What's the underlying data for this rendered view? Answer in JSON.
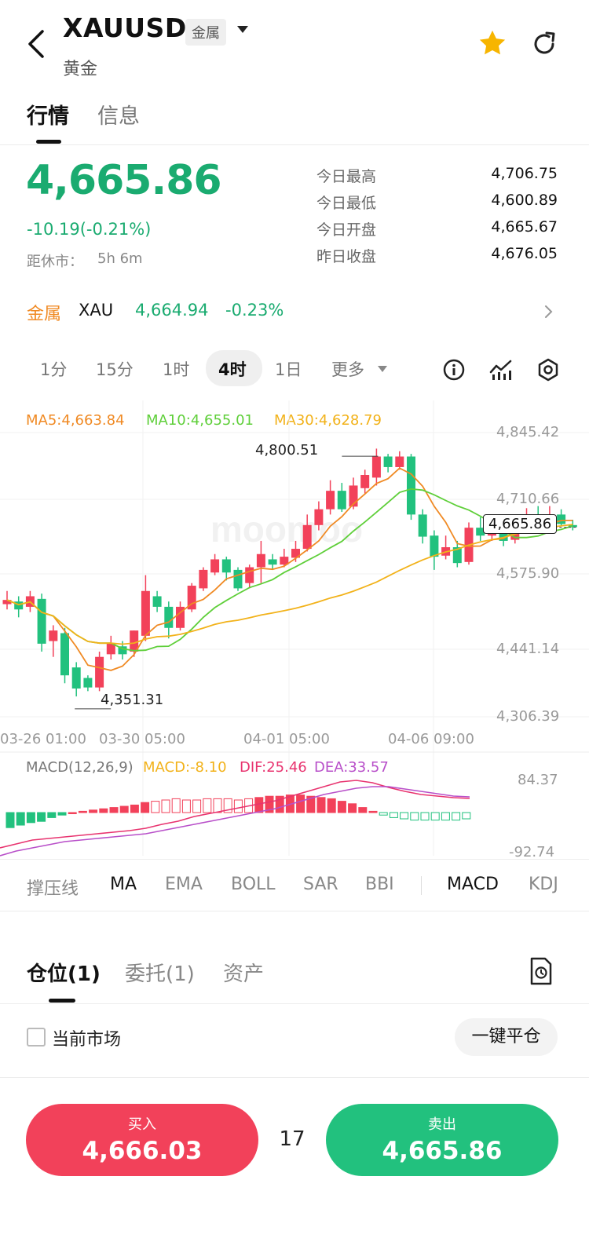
{
  "header": {
    "symbol": "XAUUSD",
    "category_badge": "金属",
    "subtitle": "黄金"
  },
  "tabs": [
    "行情",
    "信息"
  ],
  "quote": {
    "last": "4,665.86",
    "change": "-10.19(-0.21%)",
    "close_label": "距休市：",
    "close_value": "5h 6m",
    "stats": [
      {
        "label": "今日最高",
        "value": "4,706.75"
      },
      {
        "label": "今日最低",
        "value": "4,600.89"
      },
      {
        "label": "今日开盘",
        "value": "4,665.67"
      },
      {
        "label": "昨日收盘",
        "value": "4,676.05"
      }
    ]
  },
  "related": {
    "category": "金属",
    "symbol": "XAU",
    "price": "4,664.94",
    "change": "-0.23%"
  },
  "timeframes": [
    "1分",
    "15分",
    "1时",
    "4时",
    "1日",
    "更多"
  ],
  "active_timeframe": "4时",
  "colors": {
    "up": "#f2415a",
    "down": "#22c17e",
    "ma5": "#f08a24",
    "ma10": "#5fcf3a",
    "ma30": "#f2b21a",
    "dif": "#e8336f",
    "dea": "#b84fc9"
  },
  "chart": {
    "ma_legend": [
      "MA5:4,663.84",
      "MA10:4,655.01",
      "MA30:4,628.79"
    ],
    "y_ticks": [
      "4,845.42",
      "4,710.66",
      "4,575.90",
      "4,441.14",
      "4,306.39"
    ],
    "x_ticks": [
      "03-26 01:00",
      "03-30 05:00",
      "04-01 05:00",
      "04-06 09:00"
    ],
    "high_marker": "4,800.51",
    "low_marker": "4,351.31",
    "current_price": "4,665.86",
    "watermark": "moomoo"
  },
  "macd": {
    "legend": [
      "MACD(12,26,9)",
      "MACD:-8.10",
      "DIF:25.46",
      "DEA:33.57"
    ],
    "y_ticks": [
      "84.37",
      "-92.74"
    ]
  },
  "indicators": [
    "撑压线",
    "MA",
    "EMA",
    "BOLL",
    "SAR",
    "BBI",
    "MACD",
    "KDJ"
  ],
  "positions": {
    "tabs": [
      "仓位(1)",
      "委托(1)",
      "资产"
    ],
    "current_market": "当前市场",
    "close_all": "一键平仓"
  },
  "trade": {
    "buy_label": "买入",
    "buy_price": "4,666.03",
    "spread": "17",
    "sell_label": "卖出",
    "sell_price": "4,665.86"
  },
  "chart_data": {
    "type": "candlestick",
    "interval": "4h",
    "ylim": [
      4306.39,
      4845.42
    ],
    "x_ticks": [
      "03-26 01:00",
      "03-30 05:00",
      "04-01 05:00",
      "04-06 09:00"
    ],
    "high": 4800.51,
    "low": 4351.31,
    "last": 4665.86,
    "candles": [
      [
        4520,
        4528,
        4510,
        4545
      ],
      [
        4525,
        4510,
        4495,
        4535
      ],
      [
        4515,
        4535,
        4505,
        4545
      ],
      [
        4530,
        4445,
        4430,
        4540
      ],
      [
        4450,
        4470,
        4420,
        4480
      ],
      [
        4465,
        4385,
        4370,
        4475
      ],
      [
        4400,
        4360,
        4345,
        4410
      ],
      [
        4380,
        4362,
        4355,
        4385
      ],
      [
        4362,
        4420,
        4355,
        4430
      ],
      [
        4425,
        4445,
        4415,
        4460
      ],
      [
        4440,
        4425,
        4415,
        4450
      ],
      [
        4430,
        4470,
        4420,
        4470
      ],
      [
        4460,
        4545,
        4450,
        4575
      ],
      [
        4535,
        4515,
        4505,
        4545
      ],
      [
        4515,
        4475,
        4455,
        4525
      ],
      [
        4475,
        4515,
        4470,
        4525
      ],
      [
        4510,
        4555,
        4505,
        4560
      ],
      [
        4550,
        4585,
        4545,
        4590
      ],
      [
        4580,
        4605,
        4575,
        4615
      ],
      [
        4605,
        4580,
        4565,
        4610
      ],
      [
        4585,
        4550,
        4545,
        4590
      ],
      [
        4560,
        4590,
        4550,
        4595
      ],
      [
        4590,
        4615,
        4560,
        4640
      ],
      [
        4605,
        4595,
        4585,
        4615
      ],
      [
        4595,
        4610,
        4590,
        4625
      ],
      [
        4608,
        4625,
        4600,
        4640
      ],
      [
        4625,
        4670,
        4620,
        4690
      ],
      [
        4670,
        4700,
        4660,
        4715
      ],
      [
        4700,
        4735,
        4690,
        4755
      ],
      [
        4735,
        4700,
        4695,
        4750
      ],
      [
        4705,
        4745,
        4700,
        4760
      ],
      [
        4740,
        4765,
        4730,
        4775
      ],
      [
        4760,
        4800,
        4745,
        4815
      ],
      [
        4800,
        4780,
        4770,
        4805
      ],
      [
        4780,
        4800,
        4775,
        4810
      ],
      [
        4800,
        4690,
        4680,
        4805
      ],
      [
        4690,
        4648,
        4635,
        4700
      ],
      [
        4650,
        4610,
        4585,
        4660
      ],
      [
        4612,
        4628,
        4605,
        4650
      ],
      [
        4628,
        4598,
        4590,
        4640
      ],
      [
        4600,
        4665,
        4595,
        4675
      ],
      [
        4665,
        4650,
        4640,
        4685
      ],
      [
        4650,
        4670,
        4640,
        4680
      ],
      [
        4672,
        4640,
        4630,
        4685
      ],
      [
        4642,
        4665,
        4635,
        4675
      ],
      [
        4665,
        4690,
        4660,
        4702
      ],
      [
        4690,
        4676,
        4670,
        4706
      ],
      [
        4676,
        4690,
        4670,
        4706
      ],
      [
        4690,
        4672,
        4668,
        4700
      ],
      [
        4670,
        4666,
        4660,
        4680
      ]
    ],
    "macd_hist": [
      -12,
      -10,
      -8,
      -7,
      -4,
      -2,
      0,
      1,
      2,
      3,
      4,
      5,
      6,
      8,
      9,
      10,
      11,
      10,
      10,
      11,
      11,
      11,
      10,
      11,
      12,
      13,
      13,
      14,
      14,
      13,
      12,
      11,
      9,
      7,
      4,
      1,
      -2,
      -4,
      -5,
      -6,
      -6,
      -6,
      -6,
      -6,
      -5
    ]
  }
}
